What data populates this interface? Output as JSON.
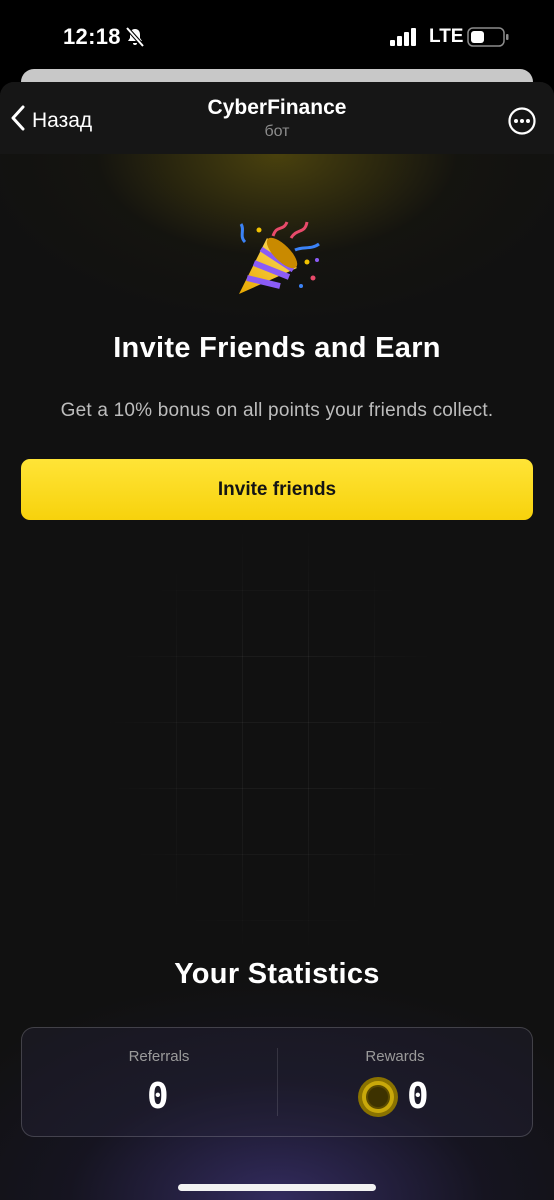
{
  "status_bar": {
    "time": "12:18",
    "network": "LTE"
  },
  "header": {
    "back_label": "Назад",
    "title": "CyberFinance",
    "subtitle": "бот"
  },
  "hero": {
    "headline": "Invite Friends and Earn",
    "description": "Get a 10% bonus on all points your friends collect.",
    "button_label": "Invite friends"
  },
  "stats": {
    "title": "Your Statistics",
    "referrals_label": "Referrals",
    "referrals_value": "0",
    "rewards_label": "Rewards",
    "rewards_value": "0"
  },
  "colors": {
    "accent": "#f7d20c",
    "background": "#111111"
  },
  "icons": [
    "bell-slash-icon",
    "signal-icon",
    "battery-icon",
    "chevron-left-icon",
    "more-icon",
    "party-popper-icon",
    "coin-icon"
  ]
}
